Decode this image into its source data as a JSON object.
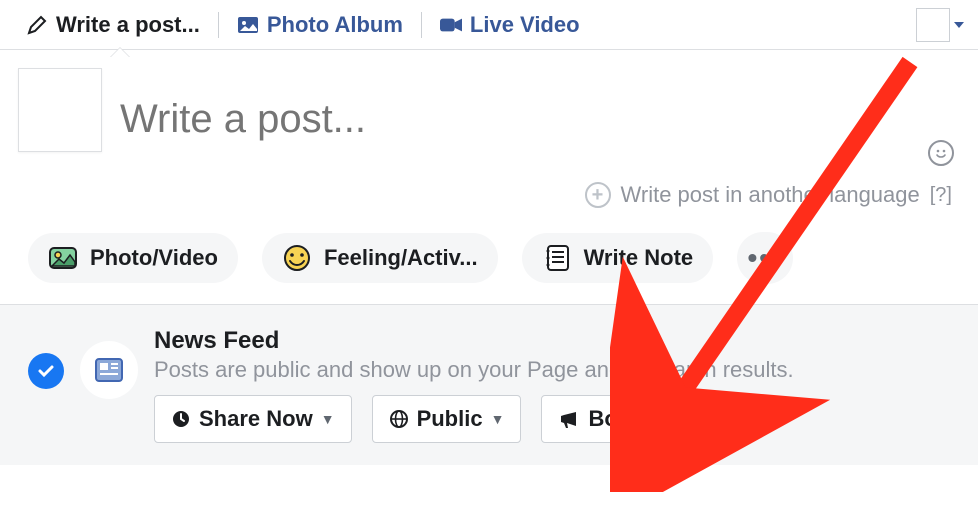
{
  "tabs": {
    "write": "Write a post...",
    "photo_album": "Photo Album",
    "live_video": "Live Video"
  },
  "composer": {
    "placeholder": "Write a post..."
  },
  "language_row": {
    "text": "Write post in another language",
    "help": "[?]"
  },
  "chips": {
    "photo_video": "Photo/Video",
    "feeling": "Feeling/Activ...",
    "write_note": "Write Note"
  },
  "feed": {
    "title": "News Feed",
    "desc": "Posts are public and show up on your Page and in search results.",
    "share_now": "Share Now",
    "public": "Public",
    "boost": "Boost Post"
  }
}
